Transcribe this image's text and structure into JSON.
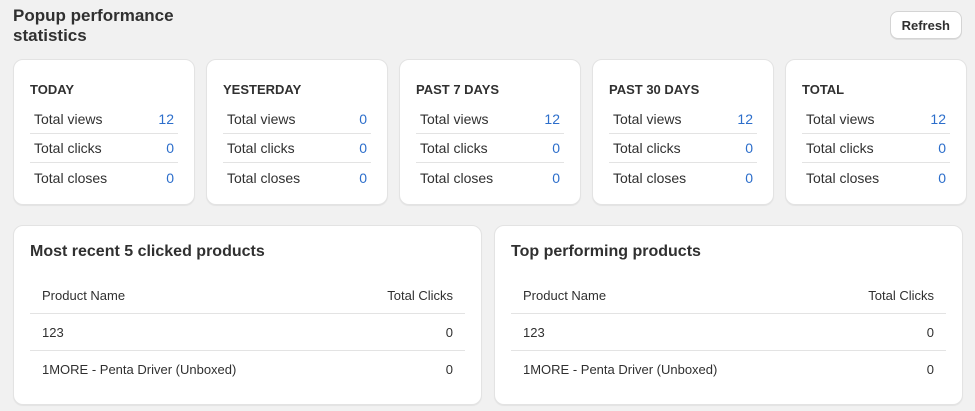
{
  "header": {
    "title": "Popup performance statistics",
    "refresh_label": "Refresh"
  },
  "stats": [
    {
      "title": "TODAY",
      "rows": [
        {
          "label": "Total views",
          "value": "12"
        },
        {
          "label": "Total clicks",
          "value": "0"
        },
        {
          "label": "Total closes",
          "value": "0"
        }
      ]
    },
    {
      "title": "YESTERDAY",
      "rows": [
        {
          "label": "Total views",
          "value": "0"
        },
        {
          "label": "Total clicks",
          "value": "0"
        },
        {
          "label": "Total closes",
          "value": "0"
        }
      ]
    },
    {
      "title": "PAST 7 DAYS",
      "rows": [
        {
          "label": "Total views",
          "value": "12"
        },
        {
          "label": "Total clicks",
          "value": "0"
        },
        {
          "label": "Total closes",
          "value": "0"
        }
      ]
    },
    {
      "title": "PAST 30 DAYS",
      "rows": [
        {
          "label": "Total views",
          "value": "12"
        },
        {
          "label": "Total clicks",
          "value": "0"
        },
        {
          "label": "Total closes",
          "value": "0"
        }
      ]
    },
    {
      "title": "TOTAL",
      "rows": [
        {
          "label": "Total views",
          "value": "12"
        },
        {
          "label": "Total clicks",
          "value": "0"
        },
        {
          "label": "Total closes",
          "value": "0"
        }
      ]
    }
  ],
  "recent_clicked": {
    "title": "Most recent 5 clicked products",
    "columns": [
      "Product Name",
      "Total Clicks"
    ],
    "rows": [
      {
        "name": "123",
        "clicks": "0"
      },
      {
        "name": "1MORE - Penta Driver (Unboxed)",
        "clicks": "0"
      }
    ]
  },
  "top_performing": {
    "title": "Top performing products",
    "columns": [
      "Product Name",
      "Total Clicks"
    ],
    "rows": [
      {
        "name": "123",
        "clicks": "0"
      },
      {
        "name": "1MORE - Penta Driver (Unboxed)",
        "clicks": "0"
      }
    ]
  },
  "colors": {
    "value_link": "#2c6ecb",
    "background": "#f1f1f1",
    "card": "#ffffff"
  }
}
